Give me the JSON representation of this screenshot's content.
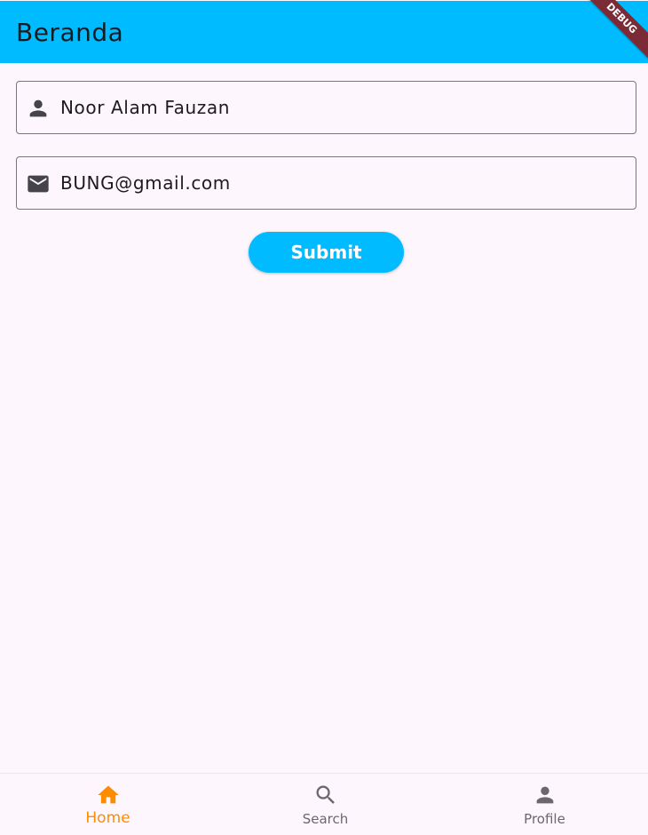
{
  "appbar": {
    "title": "Beranda",
    "debug_label": "DEBUG"
  },
  "form": {
    "name_value": "Noor Alam Fauzan",
    "email_value": "BUNG@gmail.com",
    "submit_label": "Submit"
  },
  "bottom_nav": {
    "items": [
      {
        "label": "Home",
        "icon": "home-icon",
        "active": true
      },
      {
        "label": "Search",
        "icon": "search-icon",
        "active": false
      },
      {
        "label": "Profile",
        "icon": "person-icon",
        "active": false
      }
    ]
  },
  "colors": {
    "primary": "#00bbff",
    "active_nav": "#ff8c00",
    "inactive_nav": "#6b6670",
    "background": "#fdf7fd"
  }
}
